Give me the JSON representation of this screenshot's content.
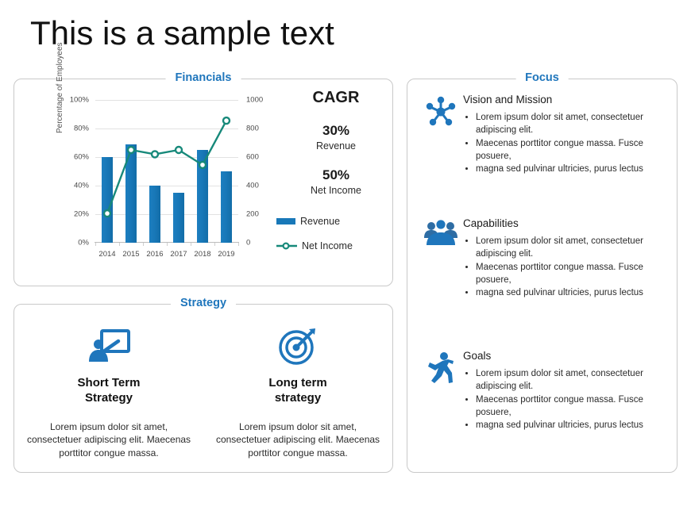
{
  "page_title": "This is a sample text",
  "financials": {
    "card_title": "Financials",
    "cagr": {
      "heading": "CAGR",
      "revenue_value": "30%",
      "revenue_label": "Revenue",
      "net_income_value": "50%",
      "net_income_label": "Net Income"
    },
    "legend": [
      {
        "label": "Revenue",
        "type": "bar",
        "color": "#1878b8"
      },
      {
        "label": "Net Income",
        "type": "line",
        "color": "#17897a"
      }
    ]
  },
  "chart_data": {
    "type": "bar",
    "title": "",
    "categories": [
      "2014",
      "2015",
      "2016",
      "2017",
      "2018",
      "2019"
    ],
    "series": [
      {
        "name": "Revenue",
        "type": "bar",
        "axis": "left",
        "color": "#1878b8",
        "values": [
          60,
          69,
          40,
          35,
          65,
          50
        ]
      },
      {
        "name": "Net Income",
        "type": "line",
        "axis": "right",
        "color": "#17897a",
        "values": [
          205,
          650,
          620,
          650,
          545,
          855
        ]
      }
    ],
    "xlabel": "",
    "ylabel": "Percentage of Employees",
    "y_left_ticks": [
      "0%",
      "20%",
      "40%",
      "60%",
      "80%",
      "100%"
    ],
    "ylim": [
      0,
      100
    ],
    "y_right_label": "",
    "y_right_ticks": [
      "0",
      "200",
      "400",
      "600",
      "800",
      "1000"
    ],
    "ylim_right": [
      0,
      1000
    ],
    "grid": true,
    "legend_position": "right"
  },
  "strategy": {
    "card_title": "Strategy",
    "columns": [
      {
        "icon": "presentation-board-icon",
        "heading": "Short Term\nStrategy",
        "heading_line1": "Short Term",
        "heading_line2": "Strategy",
        "body": "Lorem ipsum dolor sit amet, consectetuer adipiscing elit. Maecenas porttitor congue massa."
      },
      {
        "icon": "target-dart-icon",
        "heading_line1": "Long term",
        "heading_line2": "strategy",
        "body": "Lorem ipsum dolor sit amet, consectetuer adipiscing elit. Maecenas porttitor congue massa."
      }
    ]
  },
  "focus": {
    "card_title": "Focus",
    "sections": [
      {
        "icon": "network-hub-icon",
        "heading": "Vision and Mission",
        "bullets": [
          "Lorem ipsum dolor sit amet, consectetuer adipiscing  elit.",
          " Maecenas porttitor congue massa. Fusce posuere,",
          "magna sed pulvinar  ultricies, purus lectus"
        ]
      },
      {
        "icon": "people-group-icon",
        "heading": "Capabilities",
        "bullets": [
          "Lorem ipsum dolor sit amet, consectetuer adipiscing  elit.",
          " Maecenas porttitor congue massa. Fusce posuere,",
          "magna sed pulvinar  ultricies, purus lectus"
        ]
      },
      {
        "icon": "running-person-icon",
        "heading": "Goals",
        "bullets": [
          "Lorem ipsum dolor sit amet, consectetuer adipiscing  elit.",
          " Maecenas porttitor congue massa. Fusce posuere,",
          "magna sed pulvinar  ultricies, purus lectus"
        ]
      }
    ]
  },
  "colors": {
    "accent_blue": "#1F76BC",
    "bar_blue": "#1878b8",
    "line_teal": "#17897a",
    "icon_blue": "#1F76BC",
    "card_border": "#c9c9c9"
  }
}
